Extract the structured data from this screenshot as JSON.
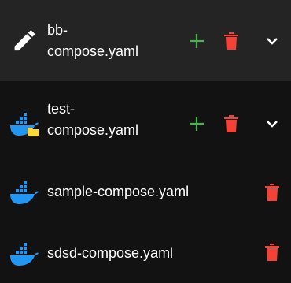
{
  "colors": {
    "background": "#121212",
    "selected_background": "#242424",
    "text": "#ffffff",
    "add": "#4caf50",
    "delete": "#f44336",
    "docker": "#2196f3",
    "folder": "#fdd835"
  },
  "files": [
    {
      "name": "bb-compose.yaml",
      "name_line1": "bb-",
      "name_line2": "compose.yaml",
      "icon": "edit-pencil-icon",
      "selected": true,
      "actions": [
        "add-icon",
        "delete-icon",
        "chevron-down-icon"
      ]
    },
    {
      "name": "test-compose.yaml",
      "name_line1": "test-",
      "name_line2": "compose.yaml",
      "icon": "docker-folder-icon",
      "selected": false,
      "actions": [
        "add-icon",
        "delete-icon",
        "chevron-down-icon"
      ]
    },
    {
      "name": "sample-compose.yaml",
      "icon": "docker-icon",
      "selected": false,
      "actions": [
        "delete-icon"
      ]
    },
    {
      "name": "sdsd-compose.yaml",
      "icon": "docker-icon",
      "selected": false,
      "actions": [
        "delete-icon"
      ]
    }
  ]
}
